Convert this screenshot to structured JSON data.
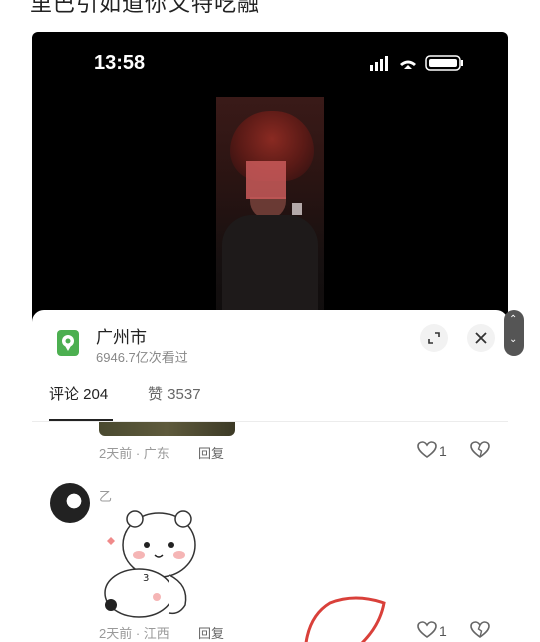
{
  "top_text": "里巴引如道你又特吃融",
  "status_bar": {
    "time": "13:58"
  },
  "location": {
    "name": "广州市",
    "views": "6946.7亿次看过"
  },
  "tabs": [
    {
      "label": "评论 204"
    },
    {
      "label": "赞 3537"
    }
  ],
  "comments": [
    {
      "meta": "2天前 · 广东",
      "reply": "回复",
      "likes": "1"
    },
    {
      "username": "乙",
      "meta": "2天前 · 江西",
      "reply": "回复",
      "likes": "1"
    }
  ],
  "icons": {
    "location": "map-pin-icon",
    "expand": "expand-icon",
    "close": "close-icon",
    "like": "heart-icon",
    "dislike": "broken-heart-icon",
    "scroll": "scroll-arrows-icon"
  },
  "colors": {
    "location_icon": "#4caf50",
    "scribble": "#d9403a"
  }
}
